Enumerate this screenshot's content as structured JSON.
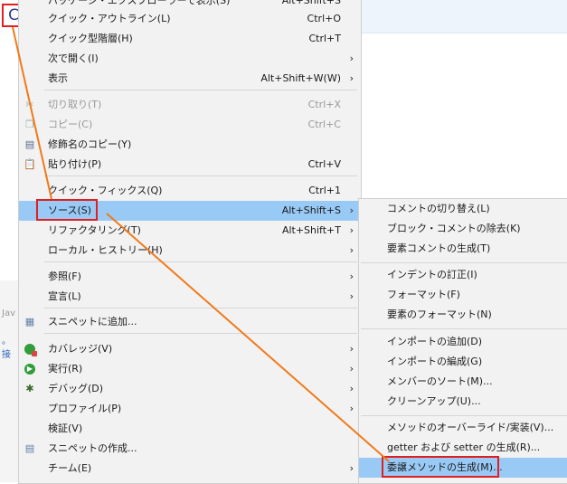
{
  "menu": {
    "items": [
      {
        "label": "パッケージ・エクスプローラーで表示(S)",
        "shortcut": "Alt+Shift+S"
      },
      {
        "label": "クイック・アウトライン(L)",
        "shortcut": "Ctrl+O"
      },
      {
        "label": "クイック型階層(H)",
        "shortcut": "Ctrl+T"
      },
      {
        "label": "次で開く(I)",
        "shortcut": ""
      },
      {
        "label": "表示",
        "shortcut": "Alt+Shift+W(W)"
      },
      {
        "label": "切り取り(T)",
        "shortcut": "Ctrl+X"
      },
      {
        "label": "コピー(C)",
        "shortcut": "Ctrl+C"
      },
      {
        "label": "修飾名のコピー(Y)",
        "shortcut": ""
      },
      {
        "label": "貼り付け(P)",
        "shortcut": "Ctrl+V"
      },
      {
        "label": "クイック・フィックス(Q)",
        "shortcut": "Ctrl+1"
      },
      {
        "label": "ソース(S)",
        "shortcut": "Alt+Shift+S"
      },
      {
        "label": "リファクタリング(T)",
        "shortcut": "Alt+Shift+T"
      },
      {
        "label": "ローカル・ヒストリー(H)",
        "shortcut": ""
      },
      {
        "label": "参照(F)",
        "shortcut": ""
      },
      {
        "label": "宣言(L)",
        "shortcut": ""
      },
      {
        "label": "スニペットに追加...",
        "shortcut": ""
      },
      {
        "label": "カバレッジ(V)",
        "shortcut": ""
      },
      {
        "label": "実行(R)",
        "shortcut": ""
      },
      {
        "label": "デバッグ(D)",
        "shortcut": ""
      },
      {
        "label": "プロファイル(P)",
        "shortcut": ""
      },
      {
        "label": "検証(V)",
        "shortcut": ""
      },
      {
        "label": "スニペットの作成...",
        "shortcut": ""
      },
      {
        "label": "チーム(E)",
        "shortcut": ""
      }
    ]
  },
  "submenu": {
    "items": [
      {
        "label": "コメントの切り替え(L)"
      },
      {
        "label": "ブロック・コメントの除去(K)"
      },
      {
        "label": "要素コメントの生成(T)"
      },
      {
        "label": "インデントの訂正(I)"
      },
      {
        "label": "フォーマット(F)"
      },
      {
        "label": "要素のフォーマット(N)"
      },
      {
        "label": "インポートの追加(D)"
      },
      {
        "label": "インポートの編成(G)"
      },
      {
        "label": "メンバーのソート(M)..."
      },
      {
        "label": "クリーンアップ(U)..."
      },
      {
        "label": "メソッドのオーバーライド/実装(V)..."
      },
      {
        "label": "getter および setter の生成(R)..."
      },
      {
        "label": "委譲メソッドの生成(M)..."
      }
    ]
  },
  "marker": {
    "letter": "C"
  },
  "background": {
    "tab_label": "Jav",
    "link_label": "。接"
  },
  "colors": {
    "highlight": "#99c9f5",
    "annotation": "#e02020",
    "arrow": "#f07a1a"
  },
  "icons": {
    "cut": "scissors-icon",
    "copy": "copy-icon",
    "qualified_copy": "document-icon",
    "paste": "clipboard-icon",
    "add_snippet": "snippet-icon",
    "coverage": "coverage-icon",
    "run": "run-icon",
    "debug": "bug-icon",
    "create_snippet": "snippet-create-icon"
  }
}
